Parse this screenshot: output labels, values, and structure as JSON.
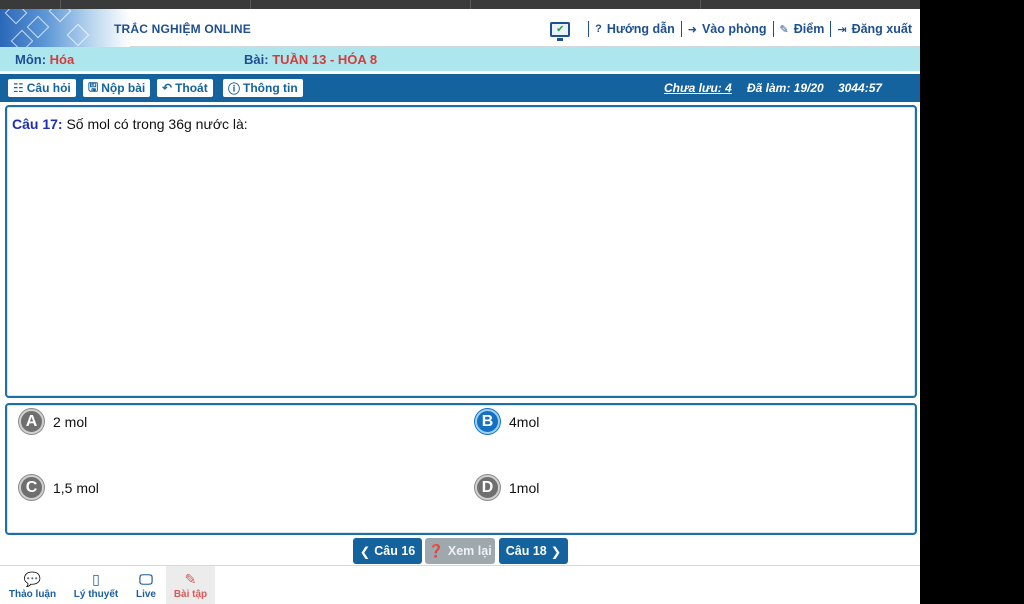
{
  "header": {
    "brand": "TRẮC NGHIỆM ONLINE",
    "nav": [
      {
        "icon": "question-icon",
        "label": "Hướng dẫn"
      },
      {
        "icon": "sign-in-icon",
        "label": "Vào phòng"
      },
      {
        "icon": "edit-icon",
        "label": "Điểm"
      },
      {
        "icon": "sign-out-icon",
        "label": "Đăng xuất"
      }
    ]
  },
  "subject": {
    "mon_label": "Môn:",
    "mon_value": "Hóa",
    "bai_label": "Bài:",
    "bai_value": "TUẦN 13 - HÓA 8"
  },
  "toolbar": {
    "buttons": [
      "Câu hỏi",
      "Nộp bài",
      "Thoát",
      "Thông tin"
    ],
    "unsaved": "Chưa lưu: 4",
    "done": "Đã làm: 19/20",
    "timer": "3044:57"
  },
  "question": {
    "number": "Câu 17:",
    "text": "Số mol có trong 36g nước là:"
  },
  "answers": [
    {
      "letter": "A",
      "text": "2 mol",
      "selected": false
    },
    {
      "letter": "B",
      "text": "4mol",
      "selected": true
    },
    {
      "letter": "C",
      "text": "1,5 mol",
      "selected": false
    },
    {
      "letter": "D",
      "text": "1mol",
      "selected": false
    }
  ],
  "navigation": {
    "prev": "Câu 16",
    "review": "Xem lại",
    "next": "Câu 18"
  },
  "bottom_tabs": [
    {
      "icon": "comments-icon",
      "label": "Thảo luận",
      "active": false
    },
    {
      "icon": "tablet-icon",
      "label": "Lý thuyết",
      "active": false
    },
    {
      "icon": "monitor-icon",
      "label": "Live",
      "active": false
    },
    {
      "icon": "edit-icon",
      "label": "Bài tập",
      "active": true
    }
  ],
  "colors": {
    "primary": "#14639e",
    "subject_bar": "#aee6ee",
    "accent_red": "#d23c3c",
    "selected_option": "#1470c2"
  }
}
